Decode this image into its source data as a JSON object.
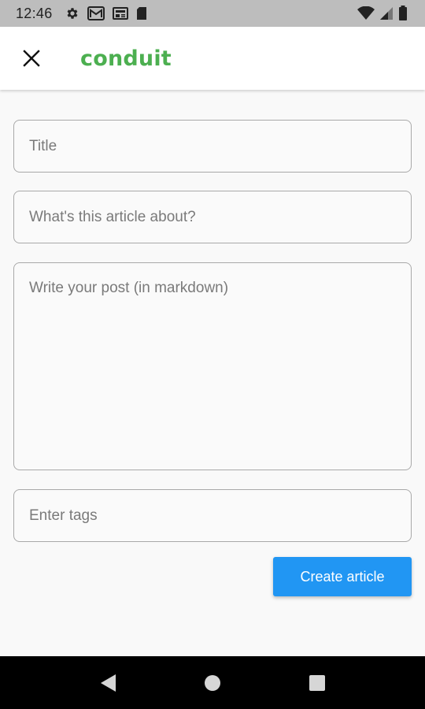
{
  "status_bar": {
    "time": "12:46",
    "icons": [
      "gear-icon",
      "gmail-icon",
      "news-icon",
      "sd-card-icon",
      "wifi-icon",
      "signal-icon",
      "battery-icon"
    ]
  },
  "app_bar": {
    "close_icon": "close-icon",
    "brand": "conduit"
  },
  "form": {
    "title_placeholder": "Title",
    "about_placeholder": "What's this article about?",
    "body_placeholder": "Write your post (in markdown)",
    "tags_placeholder": "Enter tags",
    "title_value": "",
    "about_value": "",
    "body_value": "",
    "tags_value": ""
  },
  "actions": {
    "create_label": "Create article"
  },
  "nav_bar": {
    "icons": [
      "back-icon",
      "home-icon",
      "recents-icon"
    ]
  },
  "colors": {
    "brand": "#4caf50",
    "primary_button": "#2196f3",
    "status_bar": "#bdbdbd",
    "nav_bar": "#000000"
  }
}
